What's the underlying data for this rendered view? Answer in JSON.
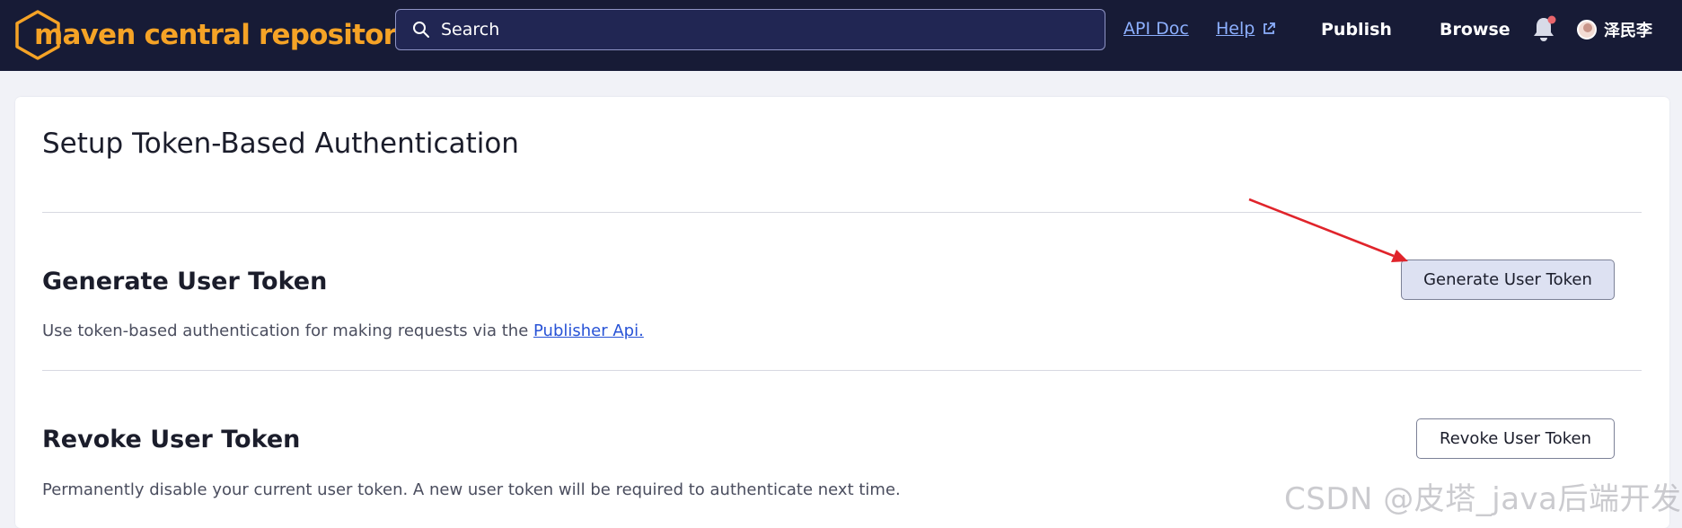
{
  "header": {
    "brand": "maven central repository",
    "search_placeholder": "Search",
    "api_doc": "API Doc",
    "help": "Help",
    "publish": "Publish",
    "browse": "Browse",
    "user_name": "泽民李",
    "brand_color": "#f5a326",
    "bg_color": "#171b36",
    "notification_dot_color": "#e8656c"
  },
  "main": {
    "title": "Setup Token-Based Authentication",
    "generate": {
      "heading": "Generate User Token",
      "description_prefix": "Use token-based authentication for making requests via the ",
      "link_text": "Publisher Api.",
      "button_label": "Generate User Token"
    },
    "revoke": {
      "heading": "Revoke User Token",
      "description": "Permanently disable your current user token. A new user token will be required to authenticate next time.",
      "button_label": "Revoke User Token"
    }
  },
  "annotation_color": "#e0242b",
  "watermark": "CSDN @皮塔_java后端开发"
}
